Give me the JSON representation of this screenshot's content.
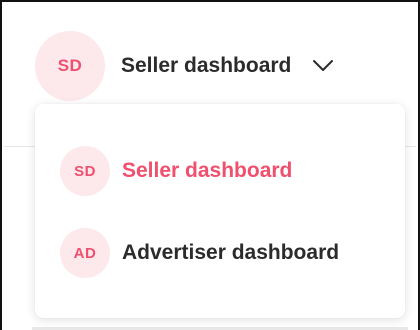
{
  "colors": {
    "accent": "#f0506e",
    "avatar_bg": "#fde8ec",
    "text_dark": "#2b2b2b"
  },
  "switcher": {
    "avatar_initials": "SD",
    "label": "Seller dashboard",
    "chevron_icon": "chevron-down-icon"
  },
  "menu": {
    "items": [
      {
        "initials": "SD",
        "label": "Seller dashboard",
        "selected": true
      },
      {
        "initials": "AD",
        "label": "Advertiser dashboard",
        "selected": false
      }
    ]
  }
}
